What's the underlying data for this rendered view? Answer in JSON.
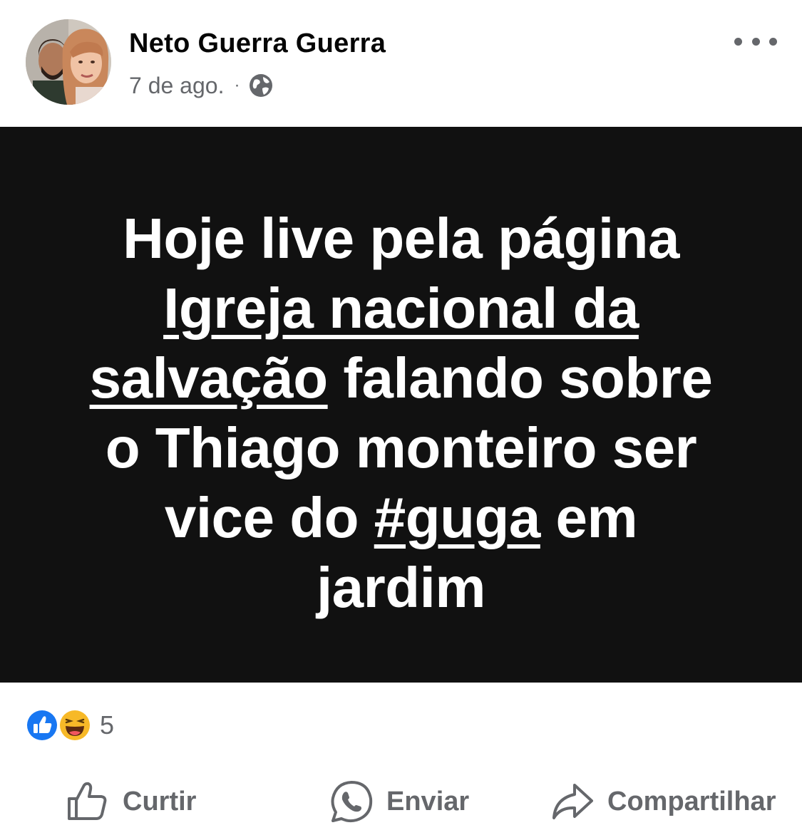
{
  "post": {
    "author_name": "Neto Guerra Guerra",
    "date": "7 de ago.",
    "separator": "·",
    "privacy_icon": "globe-icon",
    "more_icon": "more-horizontal-icon"
  },
  "image_text": {
    "line1": "Hoje live pela página",
    "line2_underlined": "Igreja nacional da",
    "line3_underlined": "salvação",
    "line3_rest": " falando sobre",
    "line4": "o Thiago monteiro ser",
    "line5_start": "vice do ",
    "line5_underlined": "#guga",
    "line5_end": " em",
    "line6": "jardim"
  },
  "reactions": {
    "icons": [
      "like-reaction-icon",
      "haha-reaction-icon"
    ],
    "count": "5"
  },
  "actions": {
    "like_label": "Curtir",
    "send_label": "Enviar",
    "share_label": "Compartilhar"
  },
  "colors": {
    "background": "#ffffff",
    "image_background": "#111111",
    "muted_text": "#65676b",
    "like_blue": "#1877f2",
    "haha_yellow": "#f7b928"
  }
}
